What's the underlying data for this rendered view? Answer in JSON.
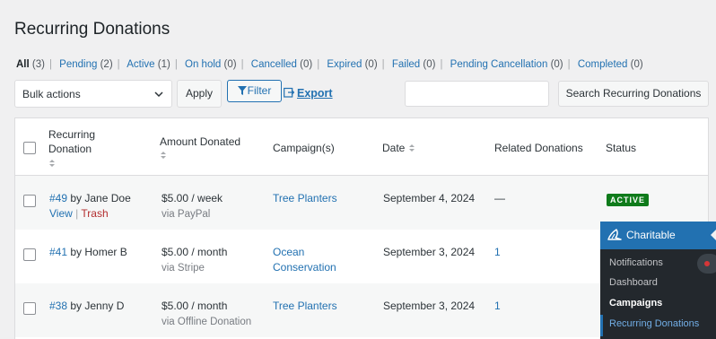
{
  "page": {
    "title": "Recurring Donations"
  },
  "filters": [
    {
      "label": "All",
      "count": "(3)",
      "current": true
    },
    {
      "label": "Pending",
      "count": "(2)"
    },
    {
      "label": "Active",
      "count": "(1)"
    },
    {
      "label": "On hold",
      "count": "(0)"
    },
    {
      "label": "Cancelled",
      "count": "(0)"
    },
    {
      "label": "Expired",
      "count": "(0)"
    },
    {
      "label": "Failed",
      "count": "(0)"
    },
    {
      "label": "Pending Cancellation",
      "count": "(0)"
    },
    {
      "label": "Completed",
      "count": "(0)"
    }
  ],
  "toolbar": {
    "bulk_actions": "Bulk actions",
    "apply": "Apply",
    "filter": "Filter",
    "export": "Export",
    "search_value": "",
    "search_button": "Search Recurring Donations"
  },
  "table": {
    "columns": {
      "recurring_donation_line1": "Recurring",
      "recurring_donation_line2": "Donation",
      "amount": "Amount Donated",
      "campaigns": "Campaign(s)",
      "date": "Date",
      "related": "Related Donations",
      "status": "Status"
    },
    "rows": [
      {
        "id": "#49",
        "by": "by Jane Doe",
        "view": "View",
        "pipe": "|",
        "trash": "Trash",
        "amount": "$5.00 / week",
        "via": "via PayPal",
        "campaign_line1": "Tree Planters",
        "campaign_line2": "",
        "date": "September 4, 2024",
        "related": "—",
        "status": "ACTIVE"
      },
      {
        "id": "#41",
        "by": "by Homer B",
        "amount": "$5.00 / month",
        "via": "via Stripe",
        "campaign_line1": "Ocean",
        "campaign_line2": "Conservation",
        "date": "September 3, 2024",
        "related": "1",
        "status": ""
      },
      {
        "id": "#38",
        "by": "by Jenny D",
        "amount": "$5.00 / month",
        "via": "via Offline Donation",
        "campaign_line1": "Tree Planters",
        "campaign_line2": "",
        "date": "September 3, 2024",
        "related": "1",
        "status": ""
      }
    ]
  },
  "admin_menu": {
    "title": "Charitable",
    "items": [
      "Notifications",
      "Dashboard",
      "Campaigns",
      "Recurring Donations"
    ]
  },
  "colors": {
    "link": "#2271b1",
    "active_badge": "#0f7b1b",
    "trash": "#b32d2e",
    "menu_bg": "#23282d",
    "menu_head": "#2271b1"
  }
}
